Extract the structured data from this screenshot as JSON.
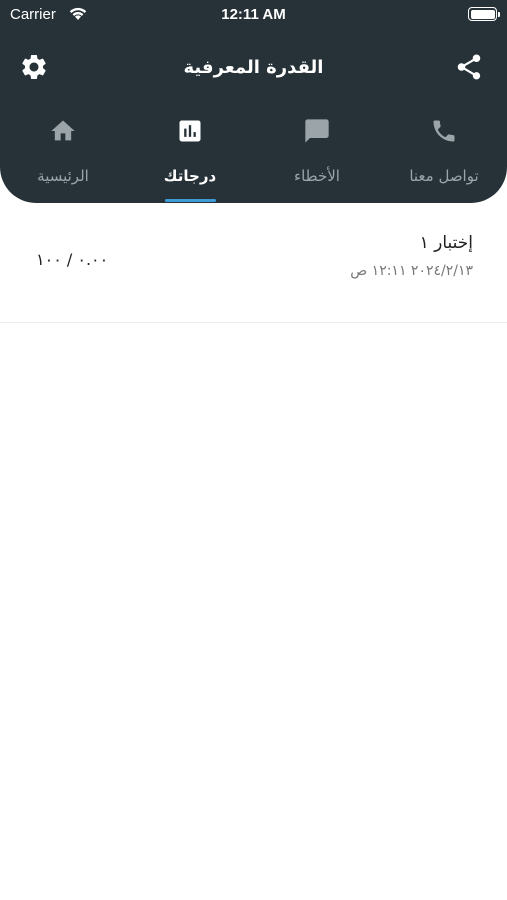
{
  "status_bar": {
    "carrier": "Carrier",
    "time": "12:11 AM"
  },
  "app_bar": {
    "title": "القدرة المعرفية",
    "settings_icon": "gear-icon",
    "share_icon": "share-icon"
  },
  "tabs": [
    {
      "label": "تواصل معنا",
      "icon": "phone-icon",
      "active": false
    },
    {
      "label": "الأخطاء",
      "icon": "chat-icon",
      "active": false
    },
    {
      "label": "درجاتك",
      "icon": "bar-chart-icon",
      "active": true
    },
    {
      "label": "الرئيسية",
      "icon": "home-icon",
      "active": false
    }
  ],
  "results": [
    {
      "name": "إختبار ١",
      "date": "٢٠٢٤/٢/١٣ ١٢:١١ ص",
      "score": "٠.٠٠ / ١٠٠"
    }
  ],
  "colors": {
    "header_bg": "#273238",
    "tab_inactive": "#9aa4a9",
    "tab_active": "#ffffff",
    "indicator": "#3f9bd6"
  }
}
